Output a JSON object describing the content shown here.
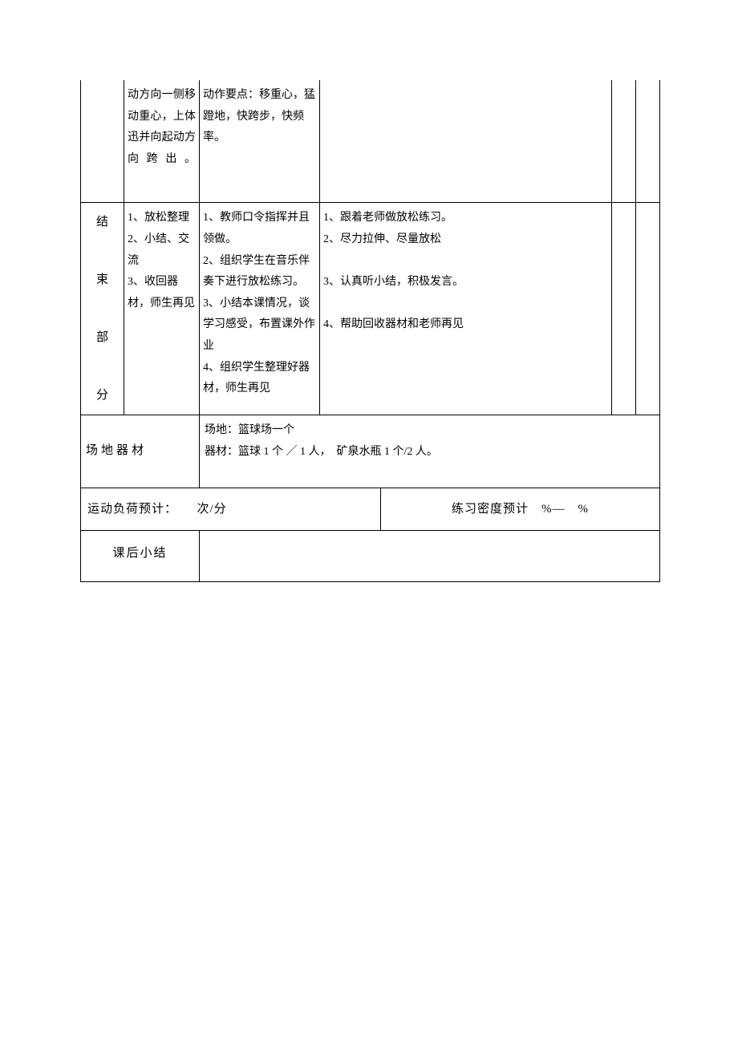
{
  "row1": {
    "col2": "动方向一侧移动重心，上体迅并向起动方向跨出。",
    "col3": "动作要点：移重心，猛蹬地，快跨步，快频率。"
  },
  "row2": {
    "sectionLabel": "结\n\n束\n\n部\n\n分",
    "col2": "1、放松整理\n2、小结、交流\n3、收回器材，师生再见",
    "col3": "1、教师口令指挥并且领做。\n2、组织学生在音乐伴奏下进行放松练习。\n3、小结本课情况，谈学习感受，布置课外作业\n4、组织学生整理好器材，师生再见",
    "col4": "1、跟着老师做放松练习。\n2、尽力拉伸、尽量放松\n\n3、认真听小结，积极发言。\n\n4、帮助回收器材和老师再见"
  },
  "row3": {
    "label": "场地器材",
    "line1": "场地：篮球场一个",
    "line2": "器材：篮球 1 个 ／ 1 人，　矿泉水瓶 1 个/2 人。"
  },
  "row4": {
    "left": "运动负荷预计：　　次/分",
    "right": "练习密度预计　%—　%"
  },
  "row5": {
    "label": "课后小结"
  }
}
